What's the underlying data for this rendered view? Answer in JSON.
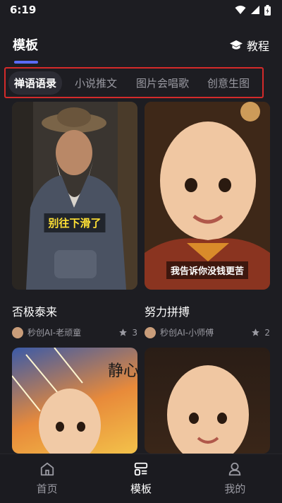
{
  "status": {
    "time": "6:19"
  },
  "header": {
    "title": "模板",
    "tutorial_label": "教程",
    "tutorial_icon": "graduation-cap-icon"
  },
  "tabs": [
    {
      "label": "禅语语录",
      "active": true
    },
    {
      "label": "小说推文",
      "active": false
    },
    {
      "label": "图片会唱歌",
      "active": false
    },
    {
      "label": "创意生图",
      "active": false
    }
  ],
  "cards": [
    {
      "title": "否极泰来",
      "caption": "别往下滑了",
      "author": "秒创AI-老顽童",
      "likes": "3"
    },
    {
      "title": "努力拼搏",
      "caption": "我告诉你没钱更苦",
      "author": "秒创AI-小师傅",
      "likes": "2"
    },
    {
      "art_text": "静心"
    },
    {}
  ],
  "bottom_nav": [
    {
      "label": "首页",
      "icon": "home-icon",
      "active": false
    },
    {
      "label": "模板",
      "icon": "template-icon",
      "active": true
    },
    {
      "label": "我的",
      "icon": "profile-icon",
      "active": false
    }
  ],
  "colors": {
    "accent": "#5a6bff",
    "highlight_border": "#d42a2a",
    "background": "#1d1d22"
  }
}
